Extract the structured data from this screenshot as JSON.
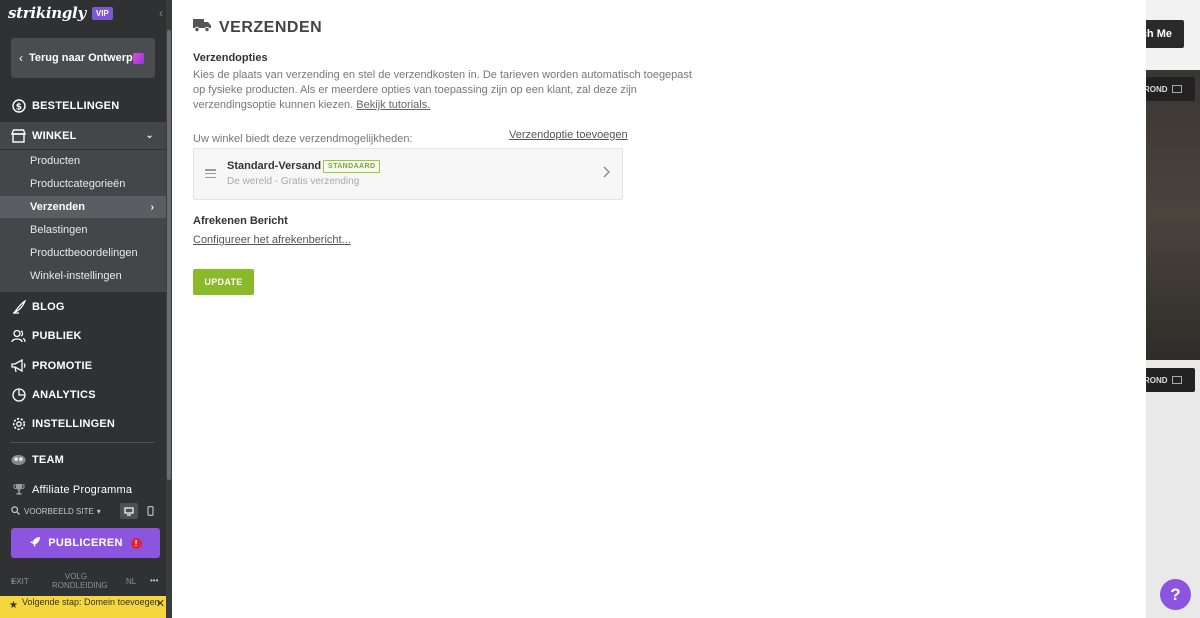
{
  "sidebar": {
    "logo": "strikingly",
    "vip_badge": "VIP",
    "back_button": "Terug naar Ontwerp",
    "nav": {
      "orders": "BESTELLINGEN",
      "shop": "WINKEL",
      "blog": "BLOG",
      "audience": "PUBLIEK",
      "promotion": "PROMOTIE",
      "analytics": "ANALYTICS",
      "settings": "INSTELLINGEN",
      "team": "TEAM",
      "affiliate": "Affiliate Programma"
    },
    "shop_submenu": [
      "Producten",
      "Productcategorieën",
      "Verzenden",
      "Belastingen",
      "Productbeoordelingen",
      "Winkel-instellingen"
    ],
    "preview_site": "VOORBEELD SITE",
    "publish_button": "PUBLICEREN",
    "publish_warning": "!",
    "footer": {
      "exit": "EXIT",
      "tour": "VOLG RONDLEIDING",
      "language": "NL",
      "more": "•••"
    },
    "next_step": "Volgende stap: Domein toevoegen"
  },
  "panel": {
    "title": "VERZENDEN",
    "shipping_options_heading": "Verzendopties",
    "description": "Kies de plaats van verzending en stel de verzendkosten in. De tarieven worden automatisch toegepast op fysieke producten. Als er meerdere opties van toepassing zijn op een klant, zal deze zijn verzendingsoptie kunnen kiezen.",
    "tutorials_link": "Bekijk tutorials.",
    "offer_label": "Uw winkel biedt deze verzendmogelijkheden:",
    "add_option_link": "Verzendoptie toevoegen",
    "shipping_option": {
      "name": "Standard-Versand",
      "badge": "STANDAARD",
      "detail": "De wereld - Gratis verzending"
    },
    "checkout_heading": "Afrekenen Bericht",
    "checkout_link": "Configureer het afrekenbericht...",
    "update_button": "UPDATE"
  },
  "background": {
    "watch_button": "ch Me",
    "bg_tag_1": "ROND",
    "bg_tag_2": "ROND",
    "help": "?"
  },
  "colors": {
    "sidebar_bg": "#2f3133",
    "sidebar_active": "#44474a",
    "accent_purple": "#8c55e0",
    "update_green": "#8ab929",
    "next_step_yellow": "#f5d63d"
  }
}
